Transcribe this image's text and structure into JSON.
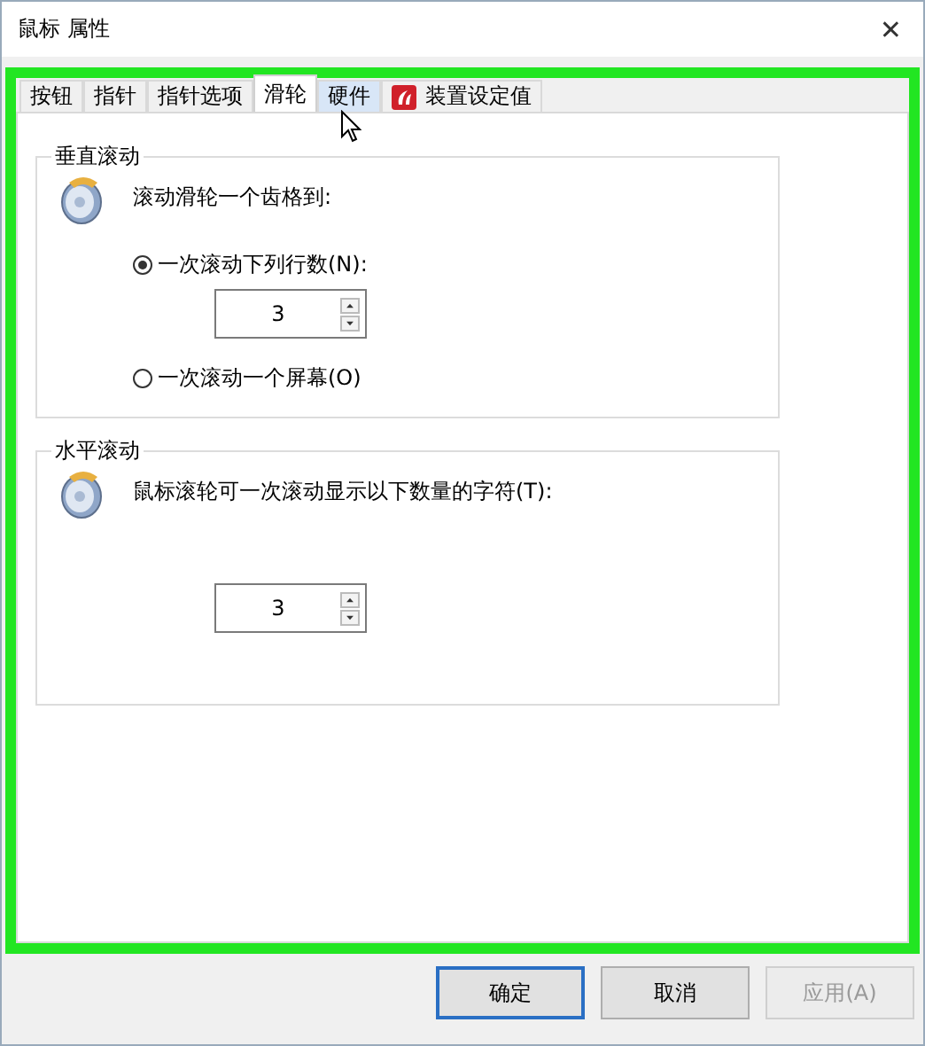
{
  "window": {
    "title": "鼠标 属性",
    "close": "✕"
  },
  "tabs": [
    {
      "label": "按钮",
      "selected": false,
      "hovered": false
    },
    {
      "label": "指针",
      "selected": false,
      "hovered": false
    },
    {
      "label": "指针选项",
      "selected": false,
      "hovered": false
    },
    {
      "label": "滑轮",
      "selected": true,
      "hovered": false
    },
    {
      "label": "硬件",
      "selected": false,
      "hovered": true
    },
    {
      "label": "装置设定值",
      "selected": false,
      "hovered": false,
      "kind": "logo"
    }
  ],
  "vertical_scrolling": {
    "title": "垂直滚动",
    "prompt": "滚动滑轮一个齿格到:",
    "options": [
      {
        "label": "一次滚动下列行数(N):",
        "selected": true,
        "spin_value": "3"
      },
      {
        "label": "一次滚动一个屏幕(O)",
        "selected": false
      }
    ]
  },
  "horizontal_scrolling": {
    "title": "水平滚动",
    "prompt": "鼠标滚轮可一次滚动显示以下数量的字符(T):",
    "spin_value": "3"
  },
  "buttons": [
    {
      "label": "确定",
      "default": true,
      "disabled": false
    },
    {
      "label": "取消",
      "default": false,
      "disabled": false
    },
    {
      "label": "应用(A)",
      "default": false,
      "disabled": true
    }
  ]
}
